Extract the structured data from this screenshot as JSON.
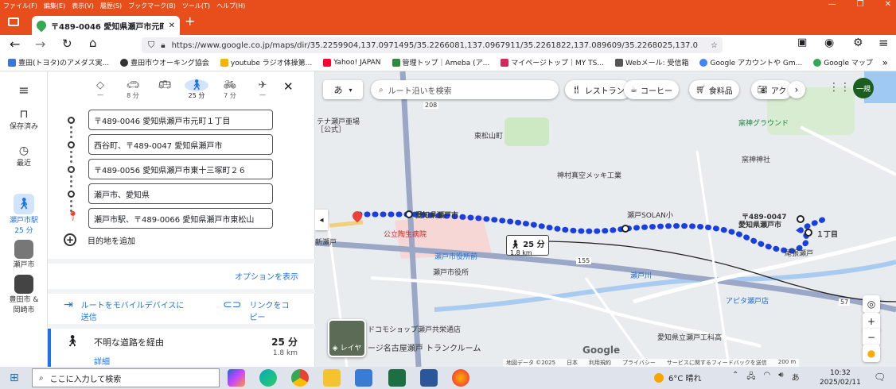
{
  "menubar": {
    "items": [
      "ファイル(F)",
      "編集(E)",
      "表示(V)",
      "履歴(S)",
      "ブックマーク(B)",
      "ツール(T)",
      "ヘルプ(H)"
    ]
  },
  "tab": {
    "title": "〒489-0046 愛知県瀬戸市元町"
  },
  "url": "https://www.google.co.jp/maps/dir/35.2259904,137.0971495/35.2266081,137.0967911/35.2261822,137.089609/35.2268025,137.0",
  "bookmarks": [
    {
      "label": "豊田(トヨタ)のアメダス実...",
      "color": "#3a77d8"
    },
    {
      "label": "豊田市ウオーキング協会",
      "color": "#333333"
    },
    {
      "label": "youtube ラジオ体操第...",
      "color": "#f4b400"
    },
    {
      "label": "Yahoo! JAPAN",
      "color": "#ff0033"
    },
    {
      "label": "管理トップ｜Ameba (ア...",
      "color": "#2d8c3c"
    },
    {
      "label": "マイページトップ｜MY TS...",
      "color": "#d6265b"
    },
    {
      "label": "Webメール: 受信箱",
      "color": "#555555"
    },
    {
      "label": "Google アカウントや Gm...",
      "color": "#4285f4"
    },
    {
      "label": "Google マップ",
      "color": "#34a853"
    }
  ],
  "rail": {
    "saved": "保存済み",
    "recent": "最近",
    "walk_active": "瀬戸市駅\n25 分",
    "walk_line1": "瀬戸市駅",
    "walk_line2": "25 分",
    "city": "瀬戸市",
    "toyota_line1": "豊田市 &",
    "toyota_line2": "岡崎市"
  },
  "modes": [
    {
      "icon": "directions-diamond-icon",
      "label": "—"
    },
    {
      "icon": "car-icon",
      "label": "8 分"
    },
    {
      "icon": "transit-icon",
      "label": ""
    },
    {
      "icon": "walk-icon",
      "label": "25 分"
    },
    {
      "icon": "bike-icon",
      "label": "7 分"
    },
    {
      "icon": "flight-icon",
      "label": "—"
    }
  ],
  "waypoints": [
    "〒489-0046 愛知県瀬戸市元町１丁目",
    "西谷町、〒489-0047 愛知県瀬戸市",
    "〒489-0056 愛知県瀬戸市東十三塚町２６",
    "瀬戸市、愛知県",
    "瀬戸市駅、〒489-0066 愛知県瀬戸市東松山"
  ],
  "add_destination": "目的地を追加",
  "options": "オプションを表示",
  "send_to_device": "ルートをモバイルデバイスに送信",
  "send_line1": "ルートをモバイルデバイスに",
  "send_line2": "送信",
  "copy_link_line1": "リンクをコ",
  "copy_link_line2": "ピー",
  "route": {
    "title": "不明な道路を経由",
    "time": "25 分",
    "distance": "1.8 km",
    "details": "詳細"
  },
  "map": {
    "search_placeholder": "ルート沿いを検索",
    "lang_button": "あ",
    "chips": [
      "レストラン",
      "コーヒー",
      "食料品",
      "アク"
    ],
    "labels": {
      "seto_city_hall_top": "愛知県瀬戸市",
      "hospital": "公立陶生病院",
      "seto_solan": "瀬戸SOLAN小",
      "postal": "〒489-0047",
      "dest": "愛知県瀬戸市",
      "dest2": "１丁目",
      "seto_city_office": "瀬戸市役所",
      "owari_seto": "尾張瀬戸",
      "apita": "アピタ瀬戸店",
      "kamimatsu": "東松山町",
      "kamimura": "神村真空メッキ工業",
      "jinja": "窯神神社",
      "ground": "窯神グラウンド",
      "seto_river": "瀬戸川",
      "shopping": "ドコモショップ瀬戸共栄通店",
      "trunkroom": "ージ名古屋瀬戸 トランクルーム",
      "school": "愛知県立瀬戸工科高",
      "new_seto": "新瀬戸",
      "seto_station": "瀬戸市役所前",
      "tenka": "テナ瀬戸亜場",
      "route_time": "25 分",
      "route_dist": "1.8 km",
      "koshiki": "［公式］",
      "road208": "208",
      "road155": "155",
      "road57": "57"
    },
    "layer_label": "レイヤ",
    "attribution": [
      "地図データ ©2025",
      "日本",
      "利用規約",
      "プライバシー",
      "サービスに関するフィードバックを送信",
      "200 m"
    ],
    "avatar": "一規"
  },
  "taskbar": {
    "search_placeholder": "ここに入力して検索",
    "weather": "6°C 晴れ",
    "time": "10:32",
    "date": "2025/02/11"
  },
  "colors": {
    "route": "#1a3fe0",
    "accent": "#1a73e8",
    "firefox_bar": "#e84d1c",
    "pin_red": "#ea4335"
  }
}
